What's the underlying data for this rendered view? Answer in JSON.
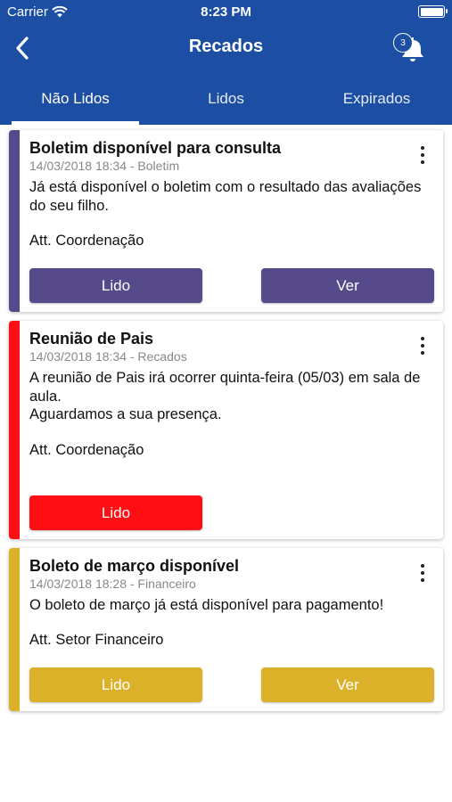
{
  "status_bar": {
    "carrier": "Carrier",
    "time": "8:23 PM"
  },
  "header": {
    "title": "Recados",
    "notification_count": "3"
  },
  "tabs": [
    {
      "label": "Não Lidos",
      "active": true
    },
    {
      "label": "Lidos",
      "active": false
    },
    {
      "label": "Expirados",
      "active": false
    }
  ],
  "colors": {
    "primary": "#1c4fa3",
    "purple": "#574a8b",
    "red": "#ff0f14",
    "yellow": "#dcb12a"
  },
  "messages": [
    {
      "title": "Boletim disponível para consulta",
      "meta": "14/03/2018 18:34 - Boletim",
      "body": "Já está disponível o boletim com o resultado das avaliações do seu filho.",
      "signature": "Att. Coordenação",
      "lido_label": "Lido",
      "ver_label": "Ver",
      "color": "#574a8b"
    },
    {
      "title": "Reunião de Pais",
      "meta": "14/03/2018 18:34 - Recados",
      "body": "A reunião de Pais irá ocorrer quinta-feira (05/03) em sala de aula.\nAguardamos a sua presença.",
      "signature": "Att. Coordenação",
      "lido_label": "Lido",
      "color": "#ff0f14"
    },
    {
      "title": "Boleto de março disponível",
      "meta": "14/03/2018 18:28 - Financeiro",
      "body": "O boleto de março já está disponível para pagamento!",
      "signature": "Att. Setor Financeiro",
      "lido_label": "Lido",
      "ver_label": "Ver",
      "color": "#dcb12a"
    }
  ]
}
